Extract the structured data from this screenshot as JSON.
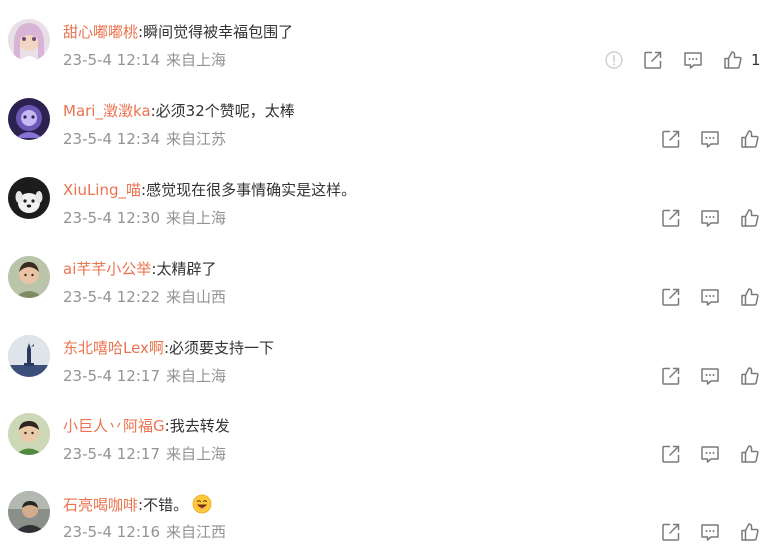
{
  "colors": {
    "username": "#eb7350",
    "text": "#333333",
    "meta": "#939393",
    "icon": "#7a7a7a"
  },
  "comments": [
    {
      "username": "甜心嘟嘟桃",
      "separator": ":",
      "content": "瞬间觉得被幸福包围了",
      "timestamp": "23-5-4 12:14",
      "location": "来自上海",
      "like_count": "1",
      "avatar_icon": "avatar-anime-girl",
      "has_report": true
    },
    {
      "username": "Mari_澂澂ka",
      "separator": ":",
      "content": "必须32个赞呢，太棒",
      "timestamp": "23-5-4 12:34",
      "location": "来自江苏",
      "like_count": "",
      "avatar_icon": "avatar-anime-purple"
    },
    {
      "username": "XiuLing_喵",
      "separator": ":",
      "content": "感觉现在很多事情确实是这样。",
      "timestamp": "23-5-4 12:30",
      "location": "来自上海",
      "like_count": "",
      "avatar_icon": "avatar-dark-dog"
    },
    {
      "username": "ai芊芊小公举",
      "separator": ":",
      "content": "太精辟了",
      "timestamp": "23-5-4 12:22",
      "location": "来自山西",
      "like_count": "",
      "avatar_icon": "avatar-child-photo"
    },
    {
      "username": "东北嘻哈Lex啊",
      "separator": ":",
      "content": "必须要支持一下",
      "timestamp": "23-5-4 12:17",
      "location": "来自上海",
      "like_count": "",
      "avatar_icon": "avatar-statue"
    },
    {
      "username": "小巨人丷阿福G",
      "separator": ":",
      "content": "我去转发",
      "timestamp": "23-5-4 12:17",
      "location": "来自上海",
      "like_count": "",
      "avatar_icon": "avatar-child-green"
    },
    {
      "username": "石亮喝咖啡",
      "separator": ":",
      "content": "不错。",
      "timestamp": "23-5-4 12:16",
      "location": "来自江西",
      "like_count": "",
      "avatar_icon": "avatar-man-photo",
      "emoji": "grin-emoji"
    }
  ]
}
